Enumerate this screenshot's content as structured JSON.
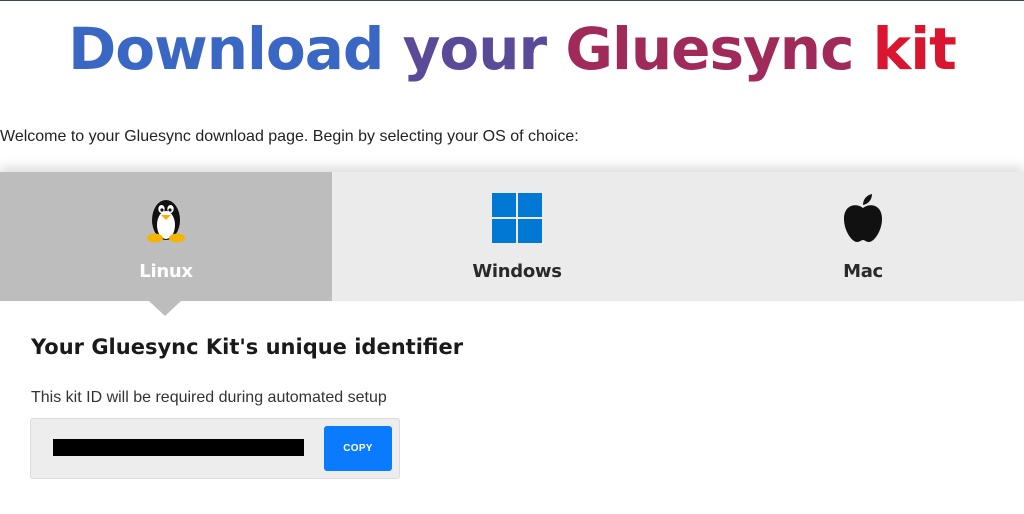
{
  "page": {
    "headline_words": [
      "Download",
      "your",
      "Gluesync",
      "kit"
    ],
    "headline_colors": [
      "#3a66c4",
      "#5b4a98",
      "#a02a5a",
      "#d9152f"
    ],
    "intro": "Welcome to your Gluesync download page. Begin by selecting your OS of choice:"
  },
  "os_tabs": [
    {
      "label": "Linux",
      "icon": "penguin-icon",
      "active": true
    },
    {
      "label": "Windows",
      "icon": "windows-logo-icon",
      "active": false
    },
    {
      "label": "Mac",
      "icon": "apple-logo-icon",
      "active": false
    }
  ],
  "kit": {
    "title": "Your Gluesync Kit's unique identifier",
    "description": "This kit ID will be required during automated setup",
    "copy_label": "COPY",
    "accent": "#0a7aff"
  }
}
